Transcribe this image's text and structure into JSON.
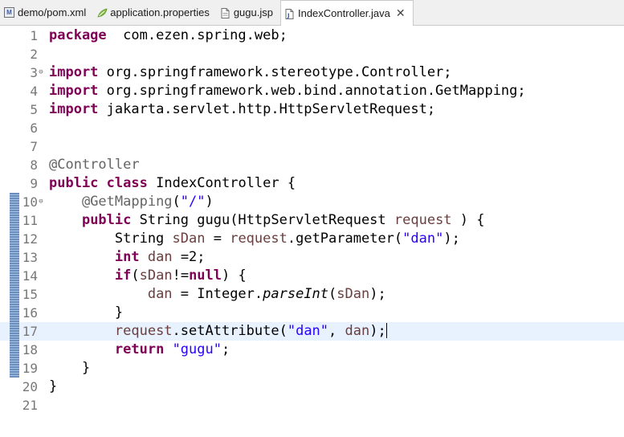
{
  "tabs": [
    {
      "label": "demo/pom.xml",
      "icon": "maven-icon",
      "active": false
    },
    {
      "label": "application.properties",
      "icon": "properties-icon",
      "active": false
    },
    {
      "label": "gugu.jsp",
      "icon": "jsp-file-icon",
      "active": false
    },
    {
      "label": "IndexController.java",
      "icon": "java-file-icon",
      "active": true,
      "close": "✕"
    }
  ],
  "editor": {
    "current_line": 17,
    "changed_lines": [
      10,
      19
    ],
    "fold_markers": [
      3,
      10
    ],
    "lines": [
      {
        "n": "1",
        "tokens": [
          [
            "kw",
            "package"
          ],
          [
            "",
            "  com.ezen.spring.web;"
          ]
        ]
      },
      {
        "n": "2",
        "tokens": []
      },
      {
        "n": "3",
        "tokens": [
          [
            "kw",
            "import"
          ],
          [
            "",
            " org.springframework.stereotype.Controller;"
          ]
        ]
      },
      {
        "n": "4",
        "tokens": [
          [
            "kw",
            "import"
          ],
          [
            "",
            " org.springframework.web.bind.annotation.GetMapping;"
          ]
        ]
      },
      {
        "n": "5",
        "tokens": [
          [
            "kw",
            "import"
          ],
          [
            "",
            " jakarta.servlet.http.HttpServletRequest;"
          ]
        ]
      },
      {
        "n": "6",
        "tokens": []
      },
      {
        "n": "7",
        "tokens": []
      },
      {
        "n": "8",
        "tokens": [
          [
            "ann",
            "@Controller"
          ]
        ]
      },
      {
        "n": "9",
        "tokens": [
          [
            "kw",
            "public"
          ],
          [
            "",
            " "
          ],
          [
            "kw",
            "class"
          ],
          [
            "",
            " IndexController {"
          ]
        ]
      },
      {
        "n": "10",
        "tokens": [
          [
            "",
            "    "
          ],
          [
            "ann",
            "@GetMapping"
          ],
          [
            "",
            "("
          ],
          [
            "str",
            "\"/\""
          ],
          [
            "",
            ")"
          ]
        ]
      },
      {
        "n": "11",
        "tokens": [
          [
            "",
            "    "
          ],
          [
            "kw",
            "public"
          ],
          [
            "",
            " String gugu(HttpServletRequest "
          ],
          [
            "fld",
            "request"
          ],
          [
            "",
            " ) {"
          ]
        ]
      },
      {
        "n": "12",
        "tokens": [
          [
            "",
            "        String "
          ],
          [
            "fld",
            "sDan"
          ],
          [
            "",
            " = "
          ],
          [
            "fld",
            "request"
          ],
          [
            "",
            ".getParameter("
          ],
          [
            "str",
            "\"dan\""
          ],
          [
            "",
            ");"
          ]
        ]
      },
      {
        "n": "13",
        "tokens": [
          [
            "",
            "        "
          ],
          [
            "kw",
            "int"
          ],
          [
            "",
            " "
          ],
          [
            "fld",
            "dan"
          ],
          [
            "",
            " =2;"
          ]
        ]
      },
      {
        "n": "14",
        "tokens": [
          [
            "",
            "        "
          ],
          [
            "kw",
            "if"
          ],
          [
            "",
            "("
          ],
          [
            "fld",
            "sDan"
          ],
          [
            "",
            "!="
          ],
          [
            "kw",
            "null"
          ],
          [
            "",
            ") {"
          ]
        ]
      },
      {
        "n": "15",
        "tokens": [
          [
            "",
            "            "
          ],
          [
            "fld",
            "dan"
          ],
          [
            "",
            " = Integer."
          ],
          [
            "itl",
            "parseInt"
          ],
          [
            "",
            "("
          ],
          [
            "fld",
            "sDan"
          ],
          [
            "",
            ");"
          ]
        ]
      },
      {
        "n": "16",
        "tokens": [
          [
            "",
            "        }"
          ]
        ]
      },
      {
        "n": "17",
        "tokens": [
          [
            "",
            "        "
          ],
          [
            "fld",
            "request"
          ],
          [
            "",
            ".setAttribute("
          ],
          [
            "str",
            "\"dan\""
          ],
          [
            "",
            ", "
          ],
          [
            "fld",
            "dan"
          ],
          [
            "",
            ");"
          ]
        ]
      },
      {
        "n": "18",
        "tokens": [
          [
            "",
            "        "
          ],
          [
            "kw",
            "return"
          ],
          [
            "",
            " "
          ],
          [
            "str",
            "\"gugu\""
          ],
          [
            "",
            ";"
          ]
        ]
      },
      {
        "n": "19",
        "tokens": [
          [
            "",
            "    }"
          ]
        ]
      },
      {
        "n": "20",
        "tokens": [
          [
            "",
            "}"
          ]
        ]
      },
      {
        "n": "21",
        "tokens": []
      }
    ]
  }
}
